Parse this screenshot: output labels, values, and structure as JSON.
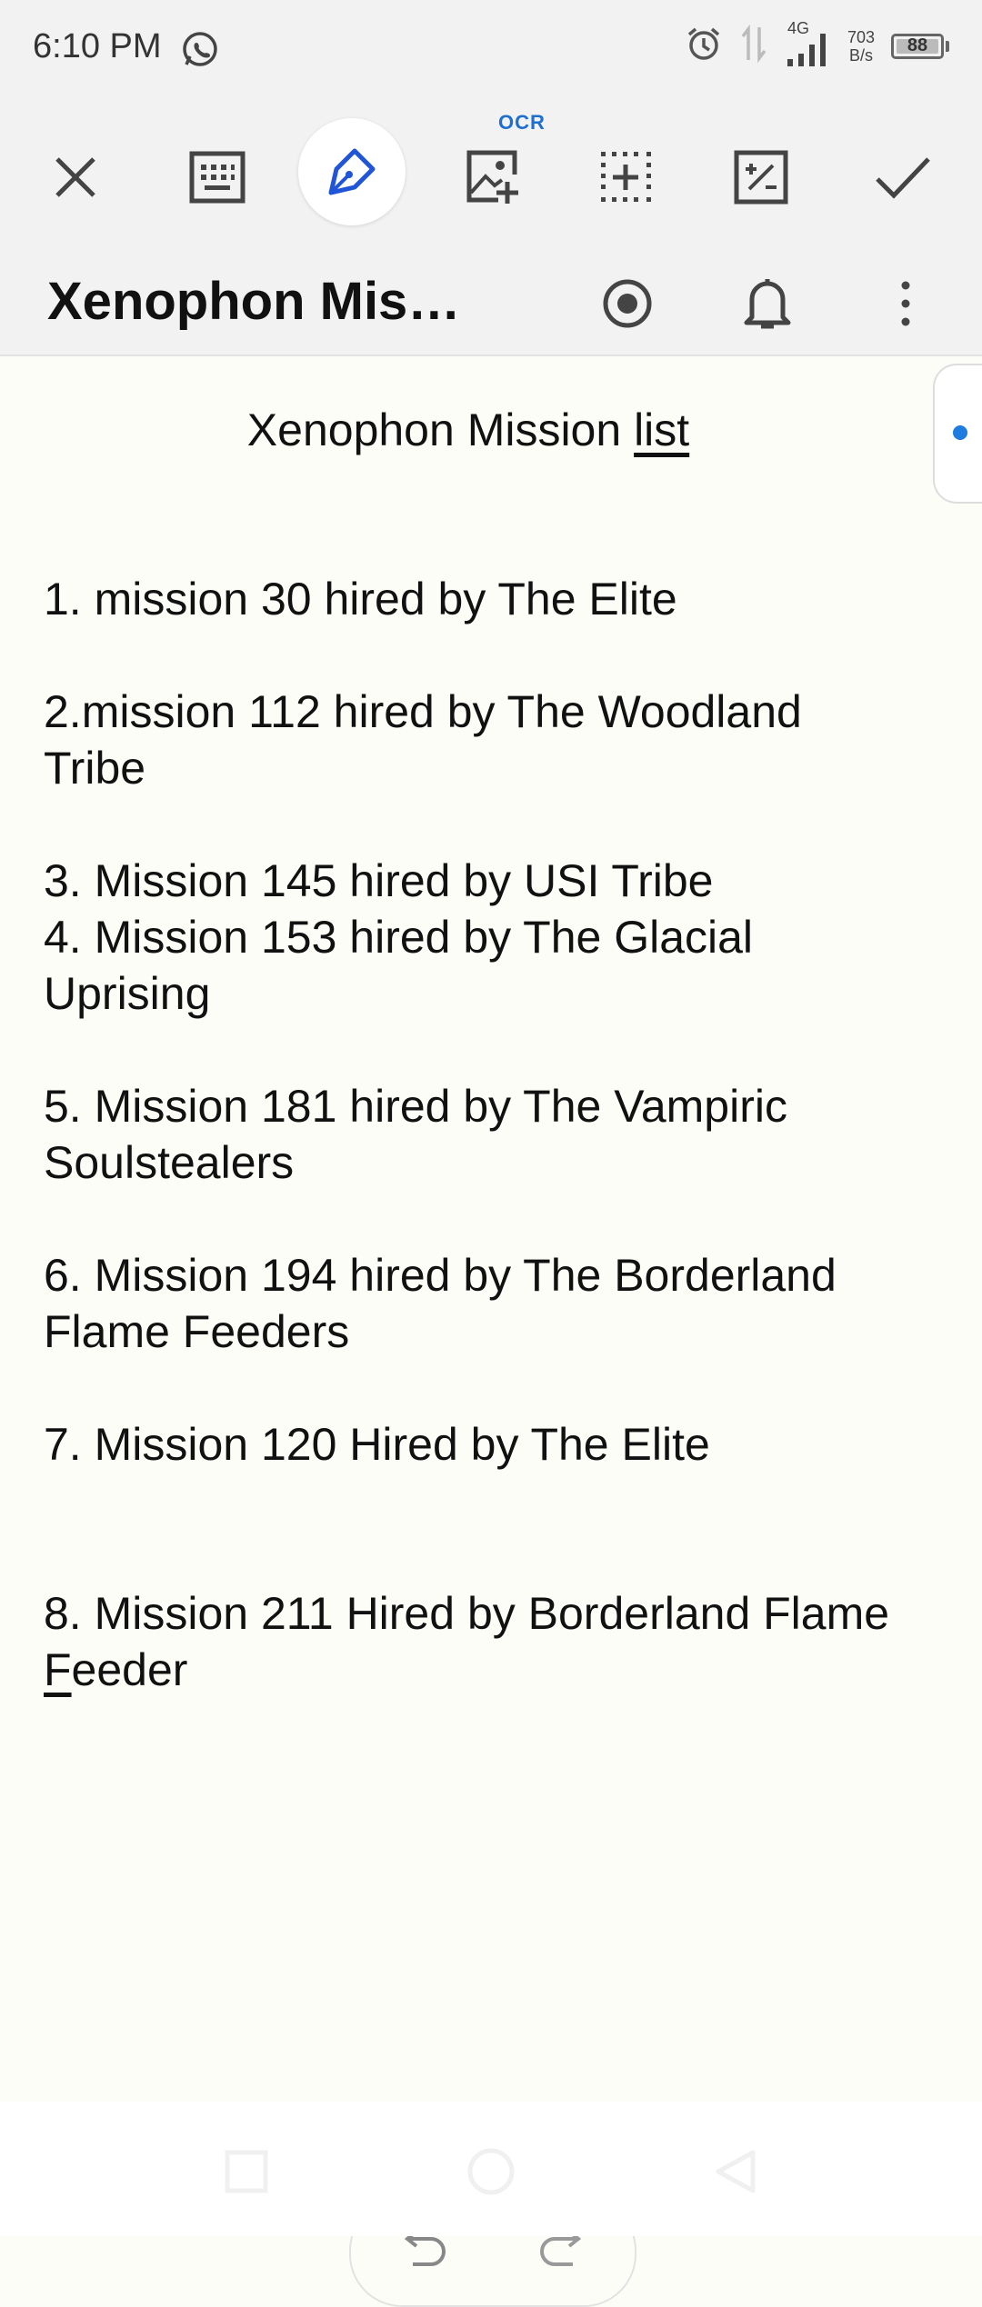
{
  "status_bar": {
    "time": "6:10 PM",
    "network_type": "4G",
    "speed_value": "703",
    "speed_unit": "B/s",
    "battery": "88"
  },
  "toolbar": {
    "ocr_label": "OCR",
    "icons": [
      "close-icon",
      "keyboard-icon",
      "pen-icon",
      "image-add-icon",
      "grid-add-icon",
      "zoom-icon",
      "check-icon"
    ]
  },
  "title_bar": {
    "title": "Xenophon Missi..."
  },
  "document": {
    "heading_main": "Xenophon Mission ",
    "heading_underlined": "list",
    "entries": [
      {
        "text": "1. mission 30 hired by The Elite"
      },
      {
        "text": "2.mission 112 hired by The Woodland\nTribe"
      },
      {
        "text": "3. Mission 145 hired by USI Tribe"
      },
      {
        "text": "4. Mission 153 hired by The Glacial\nUprising"
      },
      {
        "text": "5. Mission 181 hired by The Vampiric\nSoulstealers"
      },
      {
        "text": "6. Mission 194 hired by The Borderland\nFlame Feeders"
      },
      {
        "text": "7. Mission 120 Hired by The Elite"
      },
      {
        "text_before": "8. Mission 211 Hired by Borderland Flame\n",
        "text_underlined": "F",
        "text_after": "eeder"
      }
    ]
  },
  "colors": {
    "accent": "#1f6fd0",
    "background": "#fdfdf8",
    "bars": "#f2f2f2"
  }
}
